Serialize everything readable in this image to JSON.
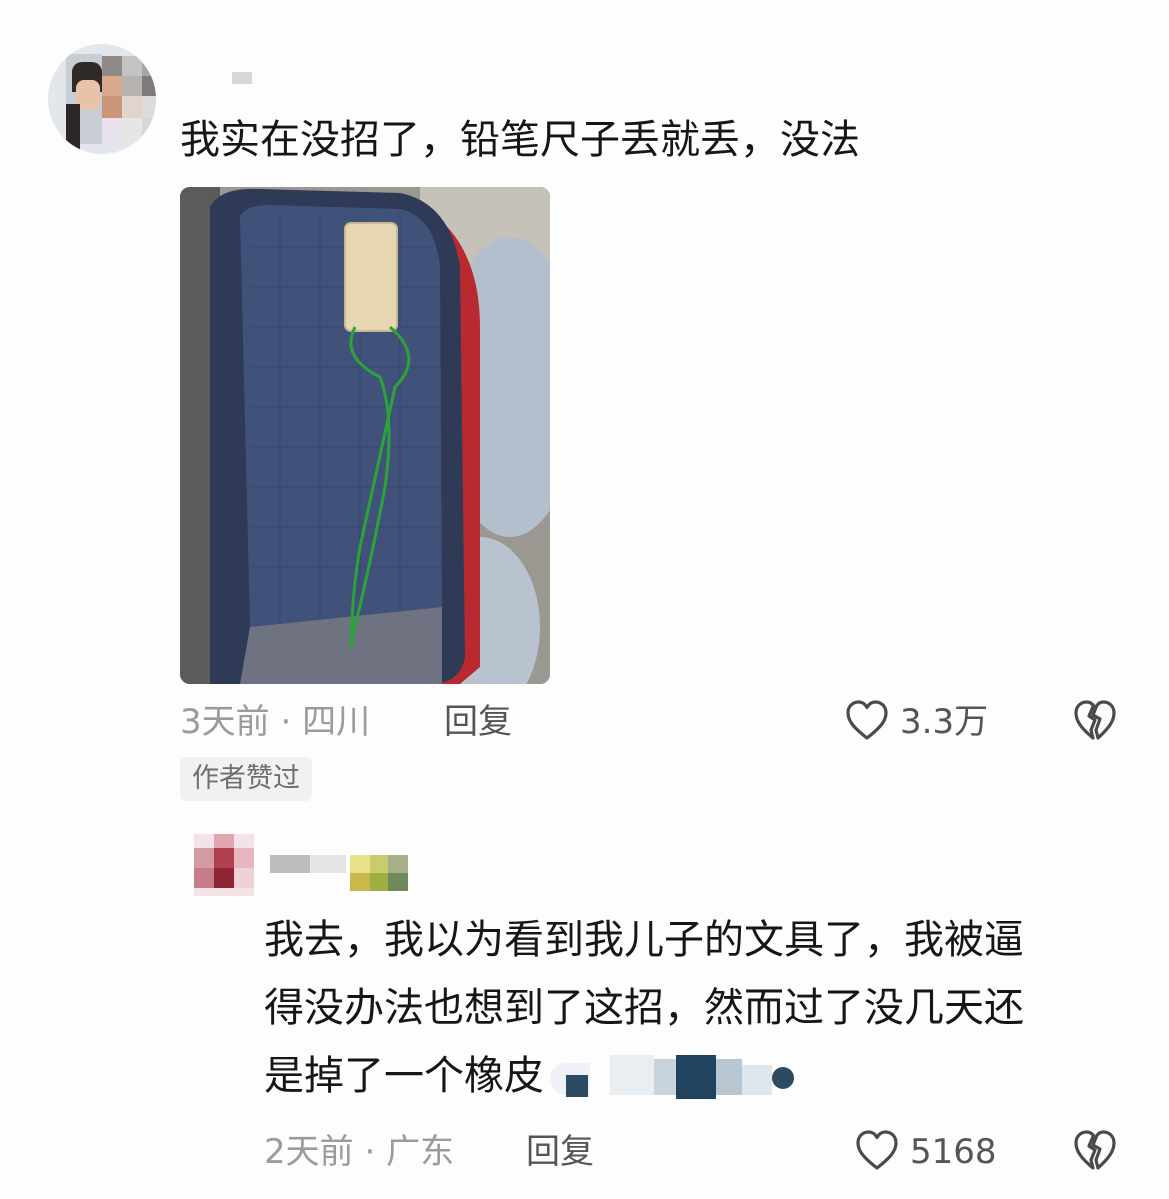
{
  "main_comment": {
    "text": "我实在没招了，铅笔尺子丢就丢，没法",
    "time": "3天前",
    "location": "四川",
    "reply_label": "回复",
    "like_count": "3.3万",
    "badge": "作者赞过"
  },
  "reply_comment": {
    "lines": [
      "我去，我以为看到我儿子的文具了，我被逼",
      "得没办法也想到了这招，然而过了没几天还",
      "是掉了一个橡皮"
    ],
    "time": "2天前",
    "location": "广东",
    "reply_label": "回复",
    "like_count": "5168"
  },
  "separator": "·",
  "icons": {
    "like": "heart-outline-icon",
    "dislike": "broken-heart-icon"
  },
  "colors": {
    "text": "#161616",
    "meta": "#9b9b9b",
    "action": "#555555",
    "badge_bg": "#f1f1f1"
  }
}
